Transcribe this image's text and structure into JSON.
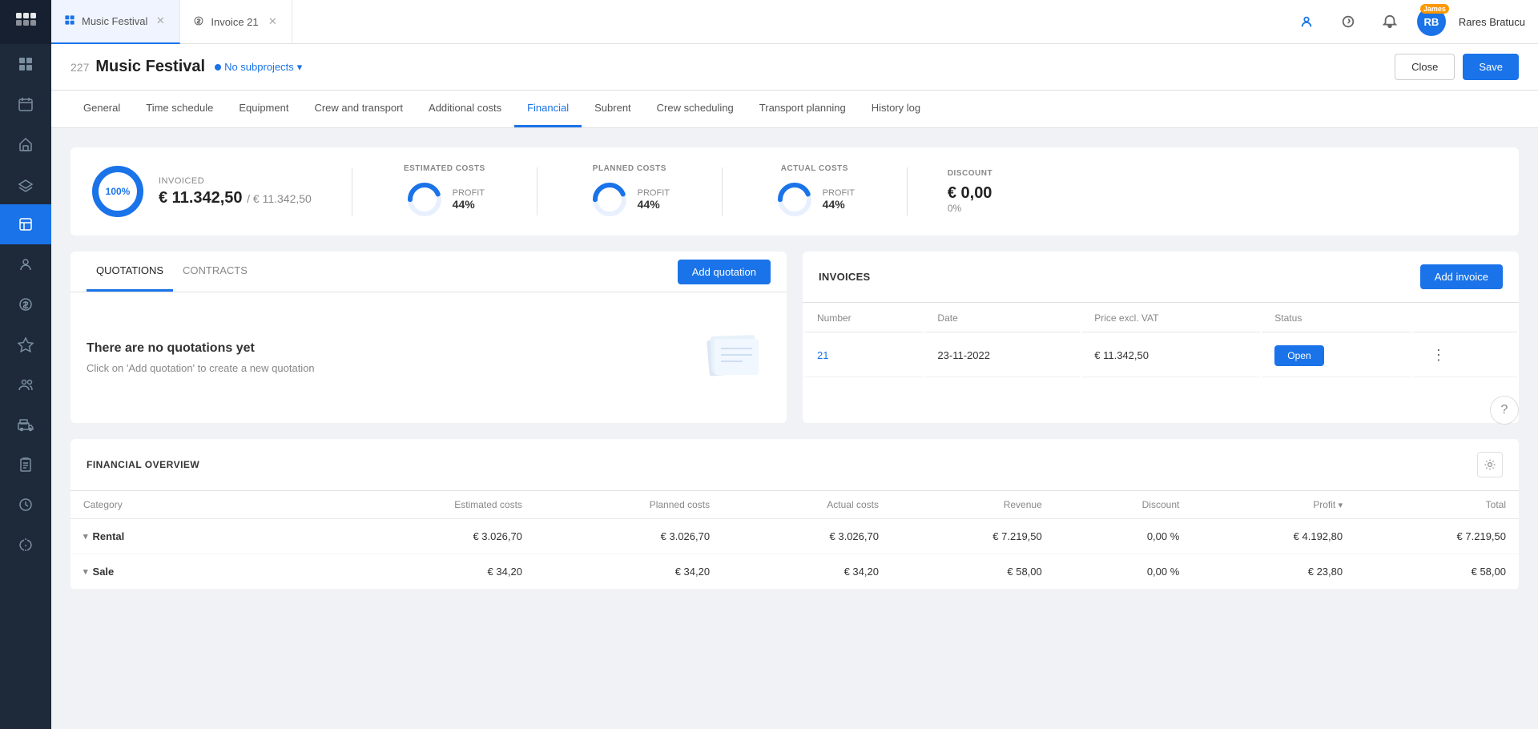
{
  "app": {
    "logo_text": "///",
    "sidebar_items": [
      {
        "id": "dashboard",
        "icon": "grid"
      },
      {
        "id": "calendar",
        "icon": "calendar"
      },
      {
        "id": "home",
        "icon": "home"
      },
      {
        "id": "projects",
        "icon": "layers"
      },
      {
        "id": "financial",
        "icon": "tool",
        "active": true
      },
      {
        "id": "contacts",
        "icon": "user"
      },
      {
        "id": "money",
        "icon": "dollar"
      },
      {
        "id": "tasks",
        "icon": "flag"
      },
      {
        "id": "team",
        "icon": "users"
      },
      {
        "id": "transport",
        "icon": "truck"
      },
      {
        "id": "clipboard",
        "icon": "clipboard"
      },
      {
        "id": "time",
        "icon": "clock"
      },
      {
        "id": "settings",
        "icon": "tool2"
      }
    ]
  },
  "tabs": [
    {
      "id": "music-festival",
      "label": "Music Festival",
      "icon": "grid",
      "active": true,
      "closeable": true
    },
    {
      "id": "invoice-21",
      "label": "Invoice 21",
      "icon": "dollar",
      "active": false,
      "closeable": true
    }
  ],
  "top_actions": {
    "avatar_initials": "RB",
    "avatar_name": "Rares Bratucu",
    "avatar_badge": "James"
  },
  "project": {
    "number": "227",
    "title": "Music Festival",
    "subproject_label": "No subprojects",
    "close_label": "Close",
    "save_label": "Save"
  },
  "nav_tabs": [
    {
      "id": "general",
      "label": "General"
    },
    {
      "id": "time-schedule",
      "label": "Time schedule"
    },
    {
      "id": "equipment",
      "label": "Equipment"
    },
    {
      "id": "crew-transport",
      "label": "Crew and transport"
    },
    {
      "id": "additional-costs",
      "label": "Additional costs"
    },
    {
      "id": "financial",
      "label": "Financial",
      "active": true
    },
    {
      "id": "subrent",
      "label": "Subrent"
    },
    {
      "id": "crew-scheduling",
      "label": "Crew scheduling"
    },
    {
      "id": "transport-planning",
      "label": "Transport planning"
    },
    {
      "id": "history-log",
      "label": "History log"
    }
  ],
  "financial_summary": {
    "progress_pct": 100,
    "invoiced_label": "INVOICED",
    "invoiced_value": "€ 11.342,50",
    "invoiced_total": "€ 11.342,50",
    "costs": [
      {
        "id": "estimated",
        "label": "ESTIMATED COSTS",
        "profit_label": "PROFIT",
        "profit_pct": "44%",
        "donut_pct": 44
      },
      {
        "id": "planned",
        "label": "PLANNED COSTS",
        "profit_label": "PROFIT",
        "profit_pct": "44%",
        "donut_pct": 44
      },
      {
        "id": "actual",
        "label": "ACTUAL COSTS",
        "profit_label": "PROFIT",
        "profit_pct": "44%",
        "donut_pct": 44
      }
    ],
    "discount_label": "DISCOUNT",
    "discount_value": "€ 0,00",
    "discount_pct": "0%"
  },
  "quotations": {
    "tab_quotations": "QUOTATIONS",
    "tab_contracts": "CONTRACTS",
    "add_button": "Add quotation",
    "empty_title": "There are no quotations yet",
    "empty_subtitle": "Click on 'Add quotation' to create a new quotation"
  },
  "invoices": {
    "title": "INVOICES",
    "add_button": "Add invoice",
    "columns": [
      "Number",
      "Date",
      "Price excl. VAT",
      "Status"
    ],
    "rows": [
      {
        "number": "21",
        "date": "23-11-2022",
        "price": "€ 11.342,50",
        "status": "Open"
      }
    ]
  },
  "financial_overview": {
    "title": "FINANCIAL OVERVIEW",
    "columns": [
      "Category",
      "Estimated costs",
      "Planned costs",
      "Actual costs",
      "Revenue",
      "Discount",
      "Profit",
      "Total"
    ],
    "rows": [
      {
        "category": "Rental",
        "estimated": "€ 3.026,70",
        "planned": "€ 3.026,70",
        "actual": "€ 3.026,70",
        "revenue": "€ 7.219,50",
        "discount": "0,00",
        "discount_unit": "%",
        "profit": "€ 4.192,80",
        "currency": "€",
        "total": "7.219,50"
      },
      {
        "category": "Sale",
        "estimated": "€ 34,20",
        "planned": "€ 34,20",
        "actual": "€ 34,20",
        "revenue": "€ 58,00",
        "discount": "0,00",
        "discount_unit": "%",
        "profit": "€ 23,80",
        "currency": "€",
        "total": "58,00"
      }
    ]
  }
}
